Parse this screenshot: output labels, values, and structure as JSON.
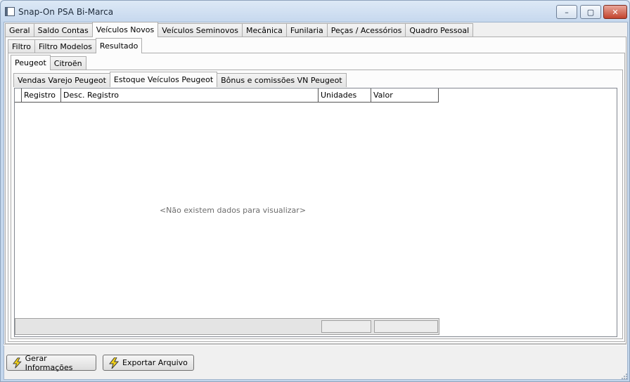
{
  "window": {
    "title": "Snap-On PSA Bi-Marca",
    "controls": {
      "minimize": "–",
      "maximize": "▢",
      "close": "✕"
    }
  },
  "main_tabs": [
    "Geral",
    "Saldo Contas",
    "Veículos Novos",
    "Veículos Seminovos",
    "Mecânica",
    "Funilaria",
    "Peças / Acessórios",
    "Quadro Pessoal"
  ],
  "main_tabs_active": "Veículos Novos",
  "sub_tabs": [
    "Filtro",
    "Filtro Modelos",
    "Resultado"
  ],
  "sub_tabs_active": "Resultado",
  "brand_tabs": [
    "Peugeot",
    "Citroën"
  ],
  "brand_tabs_active": "Peugeot",
  "report_tabs": [
    "Vendas Varejo Peugeot",
    "Estoque Veículos Peugeot",
    "Bônus e comissões VN Peugeot"
  ],
  "report_tabs_active": "Estoque Veículos Peugeot",
  "grid": {
    "columns": [
      "Registro",
      "Desc. Registro",
      "Unidades",
      "Valor"
    ],
    "empty_message": "<Não existem dados para visualizar>"
  },
  "buttons": {
    "generate": "Gerar Informações",
    "export": "Exportar Arquivo"
  },
  "icons": {
    "app": "app-window-icon",
    "button": "lightning-bolt-icon"
  },
  "colors": {
    "bolt_fill": "#f2d21b",
    "bolt_stroke": "#3a3a3a"
  }
}
